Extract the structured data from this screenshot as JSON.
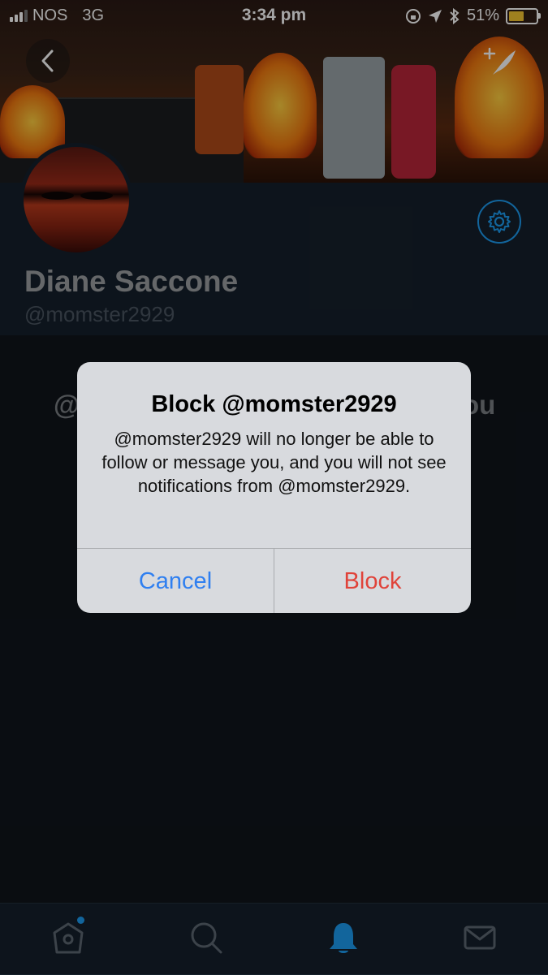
{
  "status_bar": {
    "carrier": "NOS",
    "network": "3G",
    "time": "3:34 pm",
    "battery_percent": "51%",
    "battery_level": 0.51
  },
  "header": {
    "back_icon": "chevron-left-icon",
    "compose_icon": "feather-plus-icon"
  },
  "profile": {
    "display_name": "Diane Saccone",
    "handle": "@momster2929",
    "settings_icon": "gear-icon"
  },
  "blocked_message_fragments": {
    "left": "@",
    "right": "ou"
  },
  "alert": {
    "title": "Block @momster2929",
    "message": "@momster2929 will no longer be able to follow or message you, and you will not see notifications from @momster2929.",
    "cancel_label": "Cancel",
    "block_label": "Block"
  },
  "tab_bar": {
    "tabs": [
      "home-icon",
      "search-icon",
      "bell-icon",
      "mail-icon"
    ],
    "active": "bell-icon"
  },
  "colors": {
    "accent": "#1d9bf0",
    "cancel": "#2f7ff0",
    "destructive": "#e0433a",
    "background": "#10141b",
    "profile_bg": "#15202b"
  }
}
